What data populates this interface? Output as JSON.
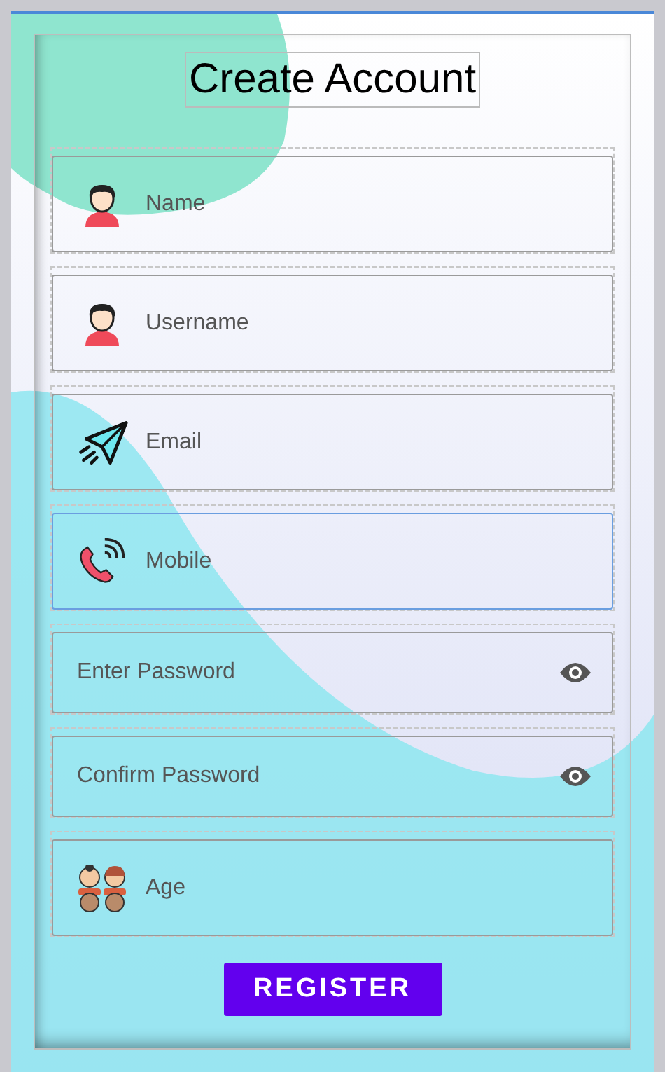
{
  "title": "Create Account",
  "fields": [
    {
      "kind": "person",
      "placeholder": "Name",
      "focused": false
    },
    {
      "kind": "person",
      "placeholder": "Username",
      "focused": false
    },
    {
      "kind": "send",
      "placeholder": "Email",
      "focused": false
    },
    {
      "kind": "phone",
      "placeholder": "Mobile",
      "focused": true
    },
    {
      "kind": "password",
      "placeholder": "Enter Password",
      "focused": false
    },
    {
      "kind": "password",
      "placeholder": "Confirm Password",
      "focused": false
    },
    {
      "kind": "kids",
      "placeholder": "Age",
      "focused": false
    }
  ],
  "register_button": "REGISTER"
}
